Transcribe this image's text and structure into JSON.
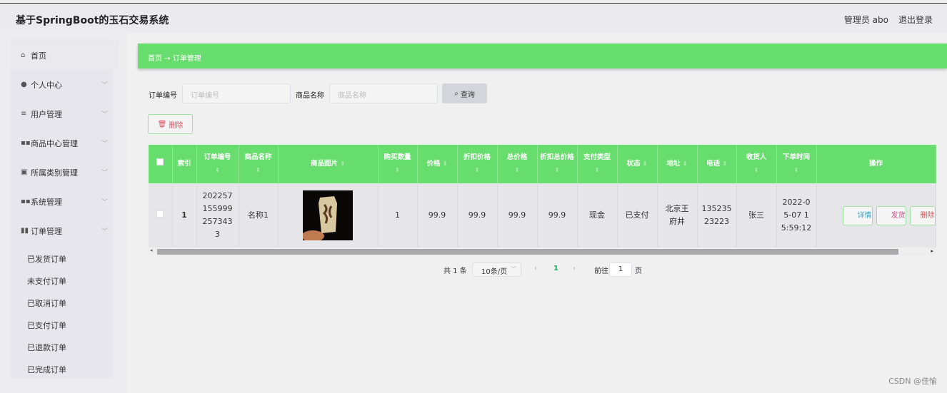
{
  "header": {
    "title": "基于SpringBoot的玉石交易系统",
    "user": "管理员 abo",
    "logout": "退出登录"
  },
  "sidebar": {
    "items": [
      {
        "label": "首页",
        "icon": "home-icon",
        "chev": false
      },
      {
        "label": "个人中心",
        "icon": "user-icon",
        "chev": true
      },
      {
        "label": "用户管理",
        "icon": "menu-icon",
        "chev": true
      },
      {
        "label": "商品中心管理",
        "icon": "grid-icon",
        "chev": true
      },
      {
        "label": "所属类别管理",
        "icon": "clipboard-icon",
        "chev": true
      },
      {
        "label": "系统管理",
        "icon": "grid-icon",
        "chev": true
      },
      {
        "label": "订单管理",
        "icon": "chart-icon",
        "chev": true
      }
    ],
    "subitems": [
      "已发货订单",
      "未支付订单",
      "已取消订单",
      "已支付订单",
      "已退款订单",
      "已完成订单"
    ]
  },
  "breadcrumb": {
    "home": "首页",
    "arrow": "→",
    "current": "订单管理"
  },
  "search": {
    "order_label": "订单编号",
    "order_placeholder": "订单编号",
    "name_label": "商品名称",
    "name_placeholder": "商品名称",
    "query": "查询",
    "delete": "删除"
  },
  "table": {
    "columns": [
      "",
      "索引",
      "订单编号",
      "商品名称",
      "商品图片",
      "购买数量",
      "价格",
      "折扣价格",
      "总价格",
      "折扣总价格",
      "支付类型",
      "状态",
      "地址",
      "电话",
      "收货人",
      "下单时间",
      "操作"
    ],
    "rows": [
      {
        "index": "1",
        "order_no": "2022571559992573433",
        "name": "名称1",
        "qty": "1",
        "price": "99.9",
        "discount_price": "99.9",
        "total": "99.9",
        "discount_total": "99.9",
        "pay_type": "现金",
        "status": "已支付",
        "address": "北京王府井",
        "phone": "13523523223",
        "receiver": "张三",
        "time": "2022-05-07 15:59:12"
      }
    ],
    "actions": [
      "详情",
      "发货",
      "删除"
    ]
  },
  "pagination": {
    "total": "共 1 条",
    "page_size": "10条/页",
    "current": "1",
    "goto": "前往",
    "goto_value": "1",
    "page_suffix": "页"
  },
  "watermark": "CSDN @佳愉",
  "colors": {
    "accent": "#66dd6c"
  }
}
